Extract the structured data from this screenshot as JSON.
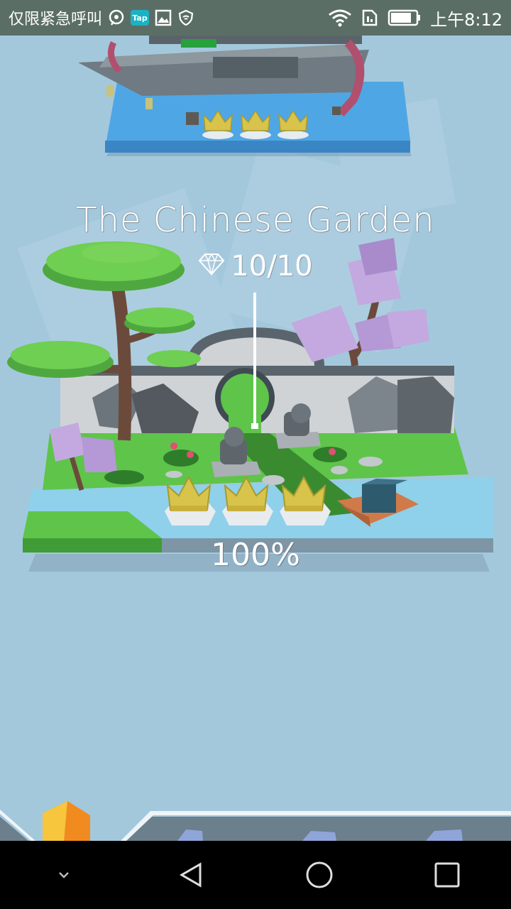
{
  "status_bar": {
    "carrier_text": "仅限紧急呼叫",
    "app_badge": "Tap",
    "time": "上午8:12",
    "icons": [
      "message-icon",
      "tap-app-icon",
      "gallery-icon",
      "vpn-shield-icon",
      "wifi-icon",
      "sim-icon",
      "battery-icon"
    ]
  },
  "level": {
    "title": "The Chinese Garden",
    "gems": "10/10",
    "progress_text": "100%",
    "progress": 1.0,
    "crowns_earned": 3,
    "crowns_total": 3
  },
  "colors": {
    "sky": "#a3c8dc",
    "grass": "#5fc44a",
    "water": "#8fd0ea",
    "blossom": "#c3a9e0",
    "crown_gold": "#d8c44a"
  },
  "nav": {
    "buttons": [
      "collapse-icon",
      "back-icon",
      "home-icon",
      "recents-icon"
    ]
  }
}
